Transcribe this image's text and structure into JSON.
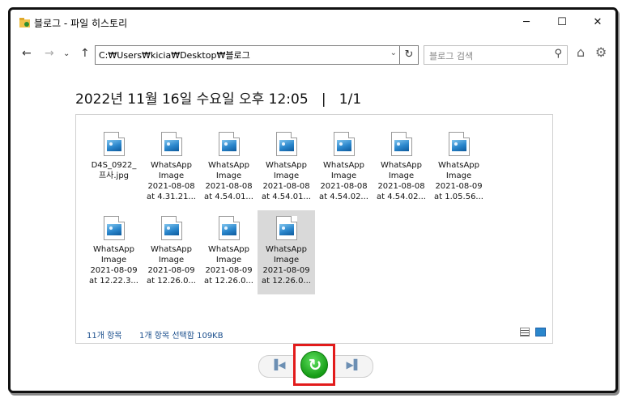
{
  "window": {
    "title": "블로그 - 파일 히스토리",
    "minimize": "─",
    "maximize": "☐",
    "close": "✕"
  },
  "toolbar": {
    "address": "C:₩Users₩kicia₩Desktop₩블로그",
    "search_placeholder": "블로그 검색"
  },
  "heading": {
    "date": "2022년 11월 16일 수요일 오후 12:05   |   1/1"
  },
  "files": [
    {
      "line1": "D4S_0922_",
      "line2": "프사.jpg",
      "line3": "",
      "line4": ""
    },
    {
      "line1": "WhatsApp",
      "line2": "Image",
      "line3": "2021-08-08",
      "line4": "at 4.31.21..."
    },
    {
      "line1": "WhatsApp",
      "line2": "Image",
      "line3": "2021-08-08",
      "line4": "at 4.54.01..."
    },
    {
      "line1": "WhatsApp",
      "line2": "Image",
      "line3": "2021-08-08",
      "line4": "at 4.54.01..."
    },
    {
      "line1": "WhatsApp",
      "line2": "Image",
      "line3": "2021-08-08",
      "line4": "at 4.54.02..."
    },
    {
      "line1": "WhatsApp",
      "line2": "Image",
      "line3": "2021-08-08",
      "line4": "at 4.54.02..."
    },
    {
      "line1": "WhatsApp",
      "line2": "Image",
      "line3": "2021-08-09",
      "line4": "at 1.05.56..."
    },
    {
      "line1": "WhatsApp",
      "line2": "Image",
      "line3": "2021-08-09",
      "line4": "at 12.22.3..."
    },
    {
      "line1": "WhatsApp",
      "line2": "Image",
      "line3": "2021-08-09",
      "line4": "at 12.26.0..."
    },
    {
      "line1": "WhatsApp",
      "line2": "Image",
      "line3": "2021-08-09",
      "line4": "at 12.26.0..."
    },
    {
      "line1": "WhatsApp",
      "line2": "Image",
      "line3": "2021-08-09",
      "line4": "at 12.26.0..."
    }
  ],
  "status": {
    "count": "11개 항목",
    "selected": "1개 항목 선택함 109KB"
  },
  "controls": {
    "prev": "▐◀",
    "next": "▶▌",
    "restore": "↻"
  },
  "colors": {
    "highlight_box": "#e21b1b",
    "restore_green": "#169c16",
    "selected_bg": "#d9d9d9"
  }
}
